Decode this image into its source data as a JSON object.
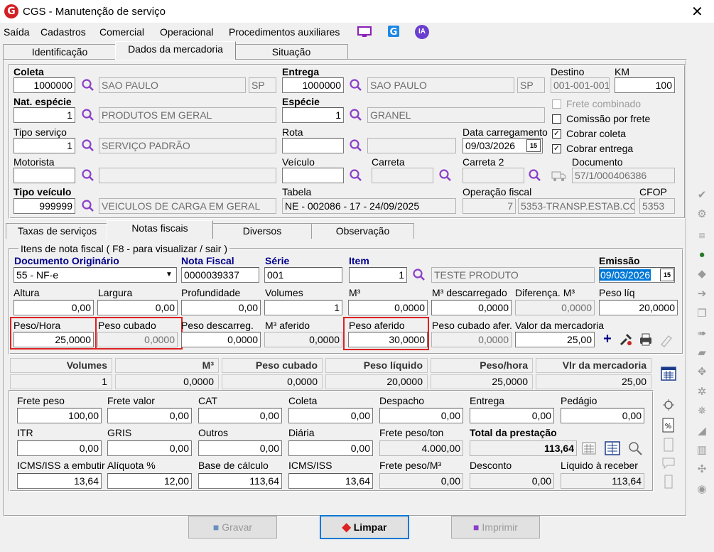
{
  "window": {
    "title": "CGS - Manutenção de serviço",
    "close": "✕",
    "logo": "G"
  },
  "menu": [
    "Saída",
    "Cadastros",
    "Comercial",
    "Operacional",
    "Procedimentos auxiliares"
  ],
  "menu_icons": {
    "ia": "IA"
  },
  "tabs": {
    "main": [
      "Identificação",
      "Dados da mercadoria",
      "Situação"
    ],
    "sub": [
      "Taxas de serviços",
      "Notas fiscais",
      "Diversos",
      "Observação"
    ]
  },
  "coleta": {
    "label": "Coleta",
    "code": "1000000",
    "city": "SAO PAULO",
    "uf": "SP"
  },
  "entrega": {
    "label": "Entrega",
    "code": "1000000",
    "city": "SAO PAULO",
    "uf": "SP"
  },
  "destino": {
    "label": "Destino",
    "value": "001-001-001"
  },
  "km": {
    "label": "KM",
    "value": "100"
  },
  "nat_especie": {
    "label": "Nat. espécie",
    "code": "1",
    "desc": "PRODUTOS EM GERAL"
  },
  "especie": {
    "label": "Espécie",
    "code": "1",
    "desc": "GRANEL"
  },
  "checks": {
    "frete_combinado": "Frete combinado",
    "comissao": "Comissão por frete",
    "cobrar_coleta": "Cobrar coleta",
    "cobrar_entrega": "Cobrar entrega",
    "check": "✓"
  },
  "tipo_servico": {
    "label": "Tipo serviço",
    "code": "1",
    "desc": "SERVIÇO PADRÃO"
  },
  "rota": {
    "label": "Rota",
    "code": "",
    "desc": ""
  },
  "data_carregamento": {
    "label": "Data carregamento",
    "value": "09/03/2026"
  },
  "motorista": {
    "label": "Motorista"
  },
  "veiculo": {
    "label": "Veículo"
  },
  "carreta": {
    "label": "Carreta"
  },
  "carreta2": {
    "label": "Carreta 2"
  },
  "documento": {
    "label": "Documento",
    "value": "57/1/000406386"
  },
  "tipo_veiculo": {
    "label": "Tipo veículo",
    "code": "999999",
    "desc": "VEICULOS DE CARGA EM GERAL"
  },
  "tabela": {
    "label": "Tabela",
    "value": "NE - 002086 - 17 - 24/09/2025"
  },
  "operacao_fiscal": {
    "label": "Operação fiscal",
    "code": "7",
    "desc": "5353-TRANSP.ESTAB.CO"
  },
  "cfop": {
    "label": "CFOP",
    "value": "5353"
  },
  "itens": {
    "legend": "Itens de nota fiscal ( F8 - para visualizar / sair )",
    "doc_orig": {
      "label": "Documento Originário",
      "value": "55 - NF-e"
    },
    "nota_fiscal": {
      "label": "Nota Fiscal",
      "value": "0000039337"
    },
    "serie": {
      "label": "Série",
      "value": "001"
    },
    "item": {
      "label": "Item",
      "code": "1",
      "desc": "TESTE PRODUTO"
    },
    "emissao": {
      "label": "Emissão",
      "value": "09/03/2026"
    },
    "altura": {
      "label": "Altura",
      "value": "0,00"
    },
    "largura": {
      "label": "Largura",
      "value": "0,00"
    },
    "profundidade": {
      "label": "Profundidade",
      "value": "0,00"
    },
    "volumes": {
      "label": "Volumes",
      "value": "1"
    },
    "m3": {
      "label": "M³",
      "value": "0,0000"
    },
    "m3_desc": {
      "label": "M³ descarregado",
      "value": "0,0000"
    },
    "dif_m3": {
      "label": "Diferença. M³",
      "value": "0,0000"
    },
    "peso_liq": {
      "label": "Peso líq",
      "value": "20,0000"
    },
    "peso_hora": {
      "label": "Peso/Hora",
      "value": "25,0000"
    },
    "peso_cubado": {
      "label": "Peso cubado",
      "value": "0,0000"
    },
    "peso_descarreg": {
      "label": "Peso descarreg.",
      "value": "0,0000"
    },
    "m3_aferido": {
      "label": "M³ aferido",
      "value": "0,0000"
    },
    "peso_aferido": {
      "label": "Peso aferido",
      "value": "30,0000"
    },
    "peso_cub_afer": {
      "label": "Peso cubado afer.",
      "value": "0,0000"
    },
    "valor_merc": {
      "label": "Valor da mercadoria",
      "value": "25,00"
    },
    "plus": "+"
  },
  "summary": {
    "headers": [
      "Volumes",
      "M³",
      "Peso cubado",
      "Peso líquido",
      "Peso/hora",
      "Vlr da mercadoria"
    ],
    "values": [
      "1",
      "0,0000",
      "0,0000",
      "20,0000",
      "25,0000",
      "25,00"
    ]
  },
  "fretes": {
    "frete_peso": {
      "label": "Frete peso",
      "value": "100,00"
    },
    "frete_valor": {
      "label": "Frete valor",
      "value": "0,00"
    },
    "cat": {
      "label": "CAT",
      "value": "0,00"
    },
    "coleta": {
      "label": "Coleta",
      "value": "0,00"
    },
    "despacho": {
      "label": "Despacho",
      "value": "0,00"
    },
    "entrega": {
      "label": "Entrega",
      "value": "0,00"
    },
    "pedagio": {
      "label": "Pedágio",
      "value": "0,00"
    },
    "itr": {
      "label": "ITR",
      "value": "0,00"
    },
    "gris": {
      "label": "GRIS",
      "value": "0,00"
    },
    "outros": {
      "label": "Outros",
      "value": "0,00"
    },
    "diaria": {
      "label": "Diária",
      "value": "0,00"
    },
    "frete_peso_ton": {
      "label": "Frete peso/ton",
      "value": "4.000,00"
    },
    "total": {
      "label": "Total da prestação",
      "value": "113,64"
    },
    "icms_embutir": {
      "label": "ICMS/ISS a embutir",
      "value": "13,64"
    },
    "aliquota": {
      "label": "Alíquota %",
      "value": "12,00"
    },
    "base_calculo": {
      "label": "Base de cálculo",
      "value": "113,64"
    },
    "icms_iss": {
      "label": "ICMS/ISS",
      "value": "13,64"
    },
    "frete_peso_m3": {
      "label": "Frete peso/M³",
      "value": "0,00"
    },
    "desconto": {
      "label": "Desconto",
      "value": "0,00"
    },
    "liquido": {
      "label": "Líquido à receber",
      "value": "113,64"
    }
  },
  "buttons": {
    "gravar": "Gravar",
    "limpar": "Limpar",
    "imprimir": "Imprimir"
  },
  "colors": {
    "highlight": "#d22222",
    "accent_blue": "#00008b",
    "ia_purple": "#6a3fd0",
    "search_purple": "#8a3fc8"
  }
}
